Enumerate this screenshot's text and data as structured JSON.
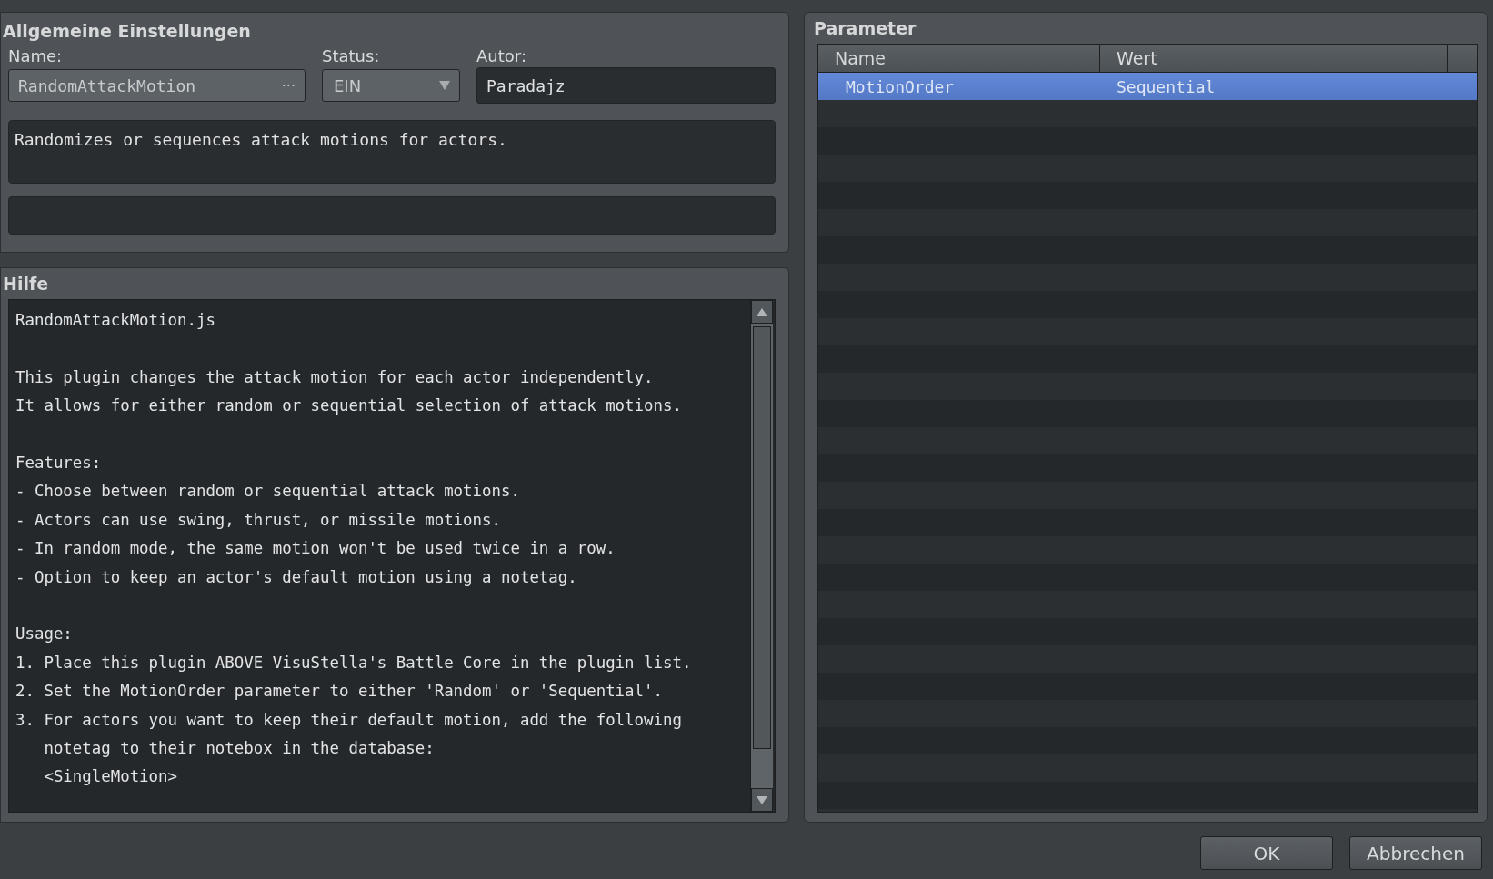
{
  "general": {
    "title": "Allgemeine Einstellungen",
    "name_label": "Name:",
    "name_value": "RandomAttackMotion",
    "name_button": "···",
    "status_label": "Status:",
    "status_value": "EIN",
    "author_label": "Autor:",
    "author_value": "Paradajz",
    "description": "Randomizes or sequences attack motions for actors."
  },
  "help": {
    "title": "Hilfe",
    "paragraphs": [
      [
        "RandomAttackMotion.js"
      ],
      [
        "This plugin changes the attack motion for each actor independently.",
        "It allows for either random or sequential selection of attack motions."
      ],
      [
        "Features:",
        "- Choose between random or sequential attack motions.",
        "- Actors can use swing, thrust, or missile motions.",
        "- In random mode, the same motion won't be used twice in a row.",
        "- Option to keep an actor's default motion using a notetag."
      ],
      [
        "Usage:",
        "1. Place this plugin ABOVE VisuStella's Battle Core in the plugin list.",
        "2. Set the MotionOrder parameter to either 'Random' or 'Sequential'.",
        "3. For actors you want to keep their default motion, add the following",
        "   notetag to their notebox in the database:",
        "   <SingleMotion>"
      ]
    ]
  },
  "parameters": {
    "title": "Parameter",
    "columns": [
      "Name",
      "Wert"
    ],
    "rows": [
      {
        "name": "MotionOrder",
        "value": "Sequential",
        "selected": true
      }
    ]
  },
  "buttons": [
    "OK",
    "Abbrechen"
  ]
}
